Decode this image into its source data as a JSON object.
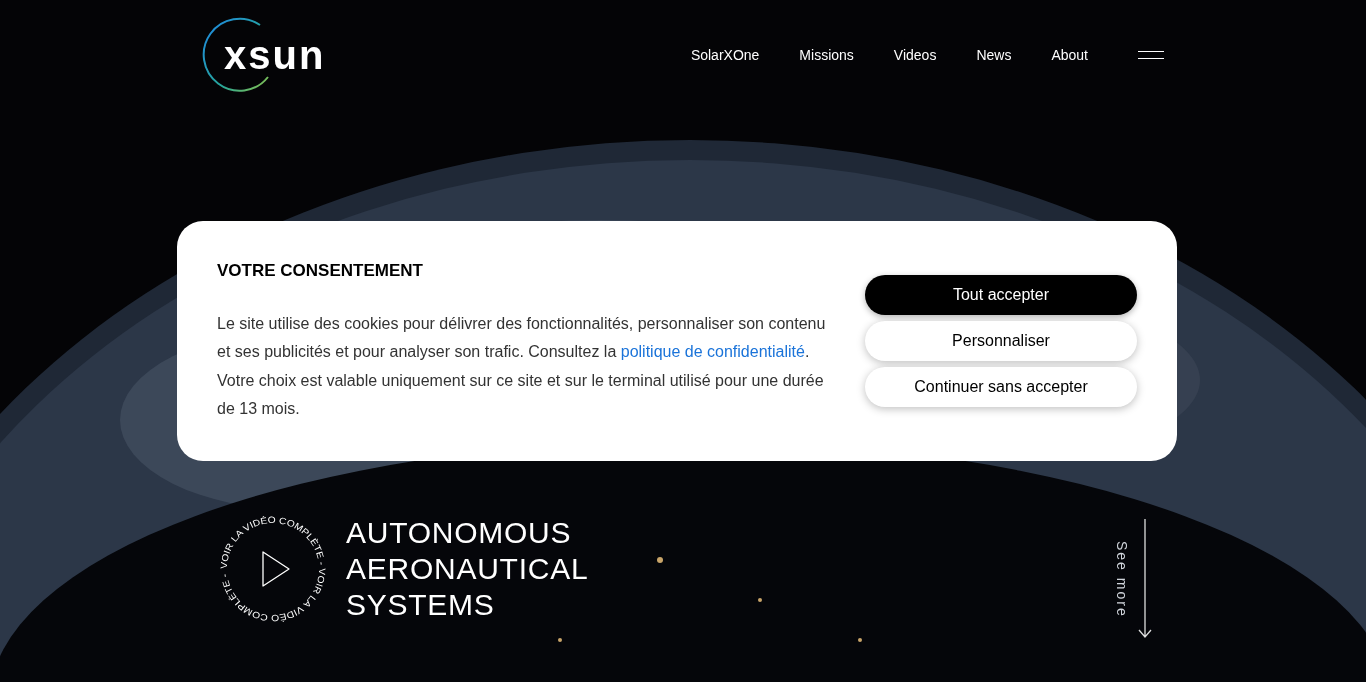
{
  "header": {
    "logo": "xsun",
    "nav": [
      "SolarXOne",
      "Missions",
      "Videos",
      "News",
      "About"
    ]
  },
  "hero": {
    "video_ring": "VOIR LA VIDÉO COMPLÈTE - VOIR LA VIDÉO COMPLÈTE -",
    "headline": [
      "AUTONOMOUS",
      "AERONAUTICAL",
      "SYSTEMS"
    ],
    "see_more": "See more"
  },
  "consent": {
    "title": "VOTRE CONSENTEMENT",
    "text_before": "Le site utilise des cookies pour délivrer des fonctionnalités, personnaliser son contenu et ses publicités et pour analyser son trafic. Consultez la ",
    "link": "politique de confidentialité",
    "text_after": ". Votre choix est valable uniquement sur ce site et sur le terminal utilisé pour une durée de 13 mois.",
    "buttons": [
      {
        "label": "Tout accepter",
        "kind": "primary"
      },
      {
        "label": "Personnaliser",
        "kind": "secondary"
      },
      {
        "label": "Continuer sans accepter",
        "kind": "secondary"
      }
    ]
  }
}
